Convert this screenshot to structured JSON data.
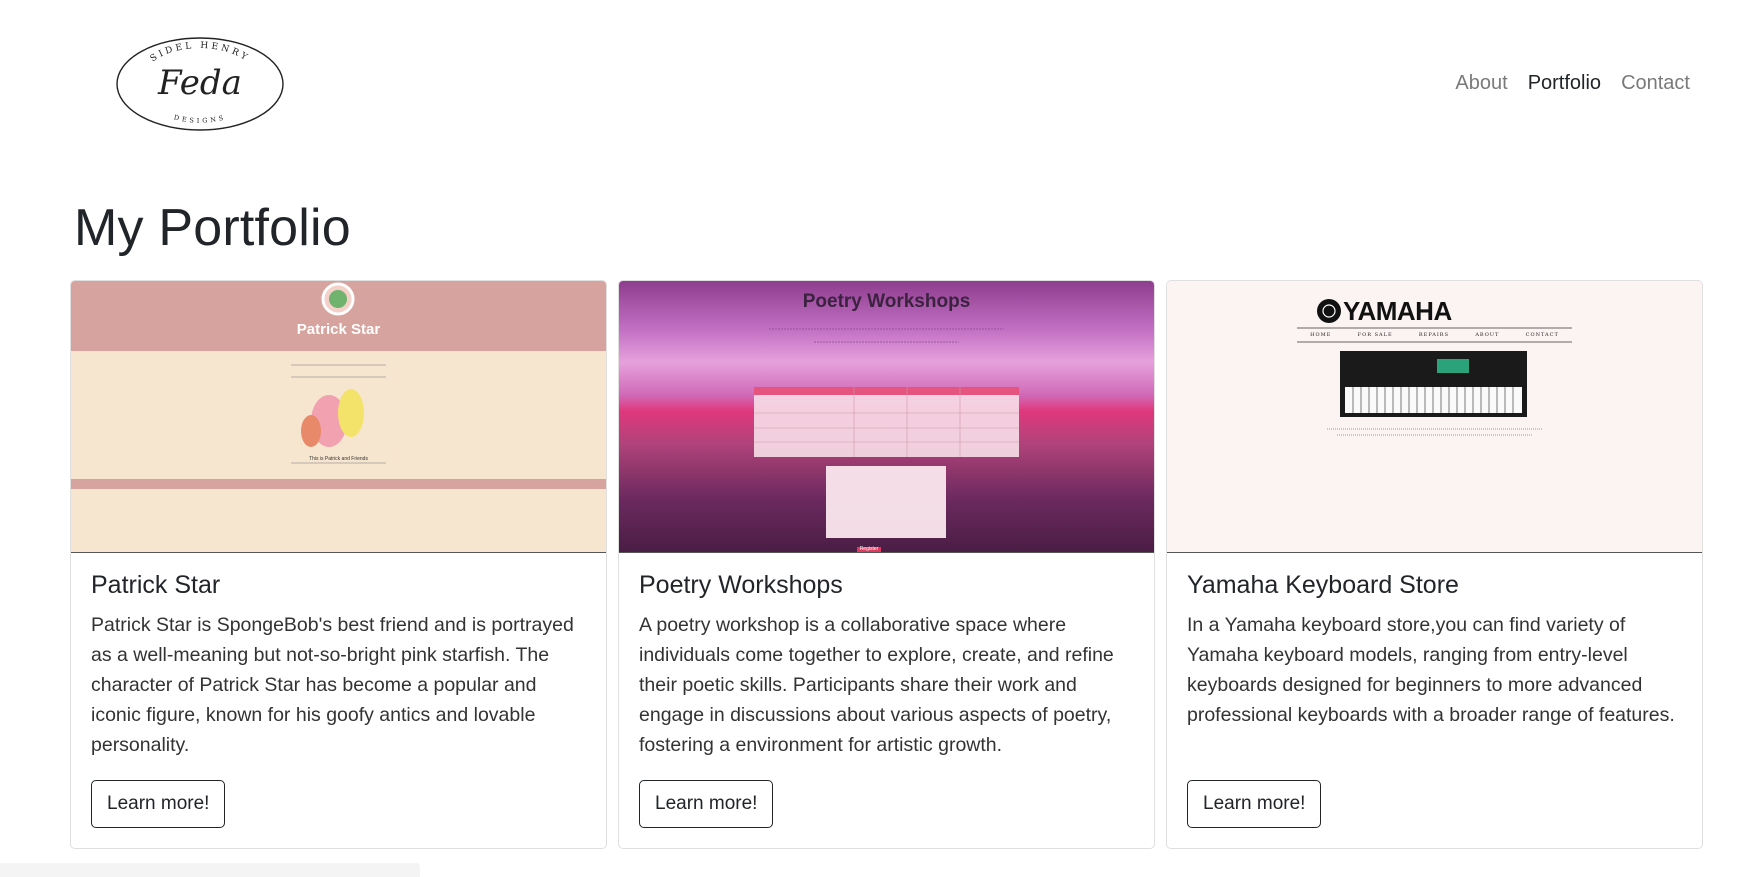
{
  "brand": {
    "logo_top_text": "SIDEL HENRY",
    "logo_script": "Feda",
    "logo_bottom_text": "DESIGNS"
  },
  "nav": {
    "items": [
      {
        "label": "About",
        "active": false
      },
      {
        "label": "Portfolio",
        "active": true
      },
      {
        "label": "Contact",
        "active": false
      }
    ]
  },
  "page": {
    "title": "My Portfolio"
  },
  "cards": [
    {
      "title": "Patrick Star",
      "text": "Patrick Star is SpongeBob's best friend and is portrayed as a well-meaning but not-so-bright pink starfish. The character of Patrick Star has become a popular and iconic figure, known for his goofy antics and lovable personality.",
      "button": "Learn more!",
      "thumb": {
        "heading": "Patrick Star",
        "caption": "This is Patrick and Friends"
      }
    },
    {
      "title": "Poetry Workshops",
      "text": "A poetry workshop is a collaborative space where individuals come together to explore, create, and refine their poetic skills. Participants share their work and engage in discussions about various aspects of poetry, fostering a environment for artistic growth.",
      "button": "Learn more!",
      "thumb": {
        "heading": "Poetry Workshops",
        "register_button": "Register"
      }
    },
    {
      "title": "Yamaha Keyboard Store",
      "text": "In a Yamaha keyboard store,you can find variety of Yamaha keyboard models, ranging from entry-level keyboards designed for beginners to more advanced professional keyboards with a broader range of features.",
      "button": "Learn more!",
      "thumb": {
        "logo": "YAMAHA",
        "menu": [
          "HOME",
          "FOR SALE",
          "REPAIRS",
          "ABOUT",
          "CONTACT"
        ]
      }
    }
  ],
  "colors": {
    "text": "#212529",
    "nav_muted": "#7a7a7a",
    "card_border": "#dfdfdf",
    "patrick_pink": "#d6a39e",
    "patrick_cream": "#f7e6cf",
    "poetry_magenta": "#e0387c",
    "yamaha_bg": "#fbf4f3"
  }
}
